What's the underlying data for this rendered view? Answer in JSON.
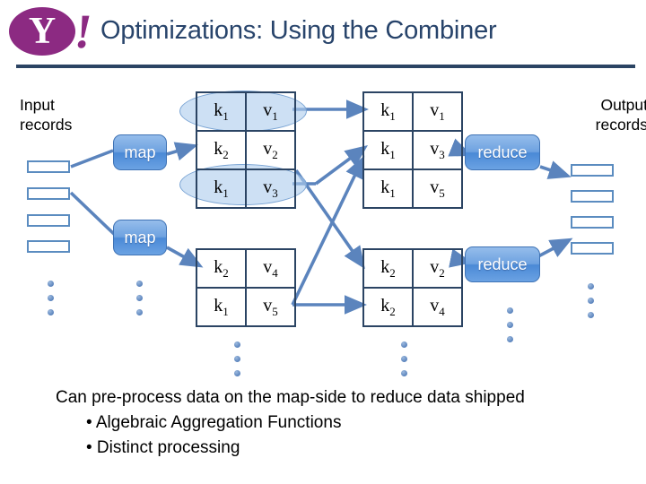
{
  "slide": {
    "title": "Optimizations: Using the Combiner",
    "logo": {
      "name": "yahoo-logo",
      "letter": "Y",
      "bang": "!",
      "oval_color": "#8c2a82"
    },
    "title_color": "#28446b",
    "rule_color": "#2b4463"
  },
  "labels": {
    "input_records": "Input\nrecords",
    "input_records_line1": "Input",
    "input_records_line2": "records",
    "output_records_line1": "Output",
    "output_records_line2": "records"
  },
  "nodes": {
    "map_1": "map",
    "map_2": "map",
    "reduce_1": "reduce",
    "reduce_2": "reduce",
    "node_fill": "#4a89d6",
    "node_text_color": "#ffffff"
  },
  "tables": {
    "map1_output": {
      "name": "map1-output-table",
      "rows": [
        {
          "key": "k",
          "key_sub": "1",
          "value": "v",
          "value_sub": "1",
          "highlighted": true
        },
        {
          "key": "k",
          "key_sub": "2",
          "value": "v",
          "value_sub": "2",
          "highlighted": false
        },
        {
          "key": "k",
          "key_sub": "1",
          "value": "v",
          "value_sub": "3",
          "highlighted": true
        }
      ]
    },
    "map2_output": {
      "name": "map2-output-table",
      "rows": [
        {
          "key": "k",
          "key_sub": "2",
          "value": "v",
          "value_sub": "4",
          "highlighted": false
        },
        {
          "key": "k",
          "key_sub": "1",
          "value": "v",
          "value_sub": "5",
          "highlighted": false
        }
      ]
    },
    "reduce1_input": {
      "name": "reduce1-input-table",
      "rows": [
        {
          "key": "k",
          "key_sub": "1",
          "value": "v",
          "value_sub": "1"
        },
        {
          "key": "k",
          "key_sub": "1",
          "value": "v",
          "value_sub": "3"
        },
        {
          "key": "k",
          "key_sub": "1",
          "value": "v",
          "value_sub": "5"
        }
      ]
    },
    "reduce2_input": {
      "name": "reduce2-input-table",
      "rows": [
        {
          "key": "k",
          "key_sub": "2",
          "value": "v",
          "value_sub": "2"
        },
        {
          "key": "k",
          "key_sub": "2",
          "value": "v",
          "value_sub": "4"
        }
      ]
    }
  },
  "records": {
    "input_count": 4,
    "output_count": 4,
    "rect_border_color": "#5b8cc0"
  },
  "dots": {
    "color": "#5b84bd",
    "columns": 4,
    "per_column": 3
  },
  "body": {
    "lead": "Can pre-process data on the map-side to reduce data shipped",
    "bullet_1": "• Algebraic Aggregation Functions",
    "bullet_2": "• Distinct processing"
  },
  "connectors": {
    "color": "#5b84bd"
  }
}
